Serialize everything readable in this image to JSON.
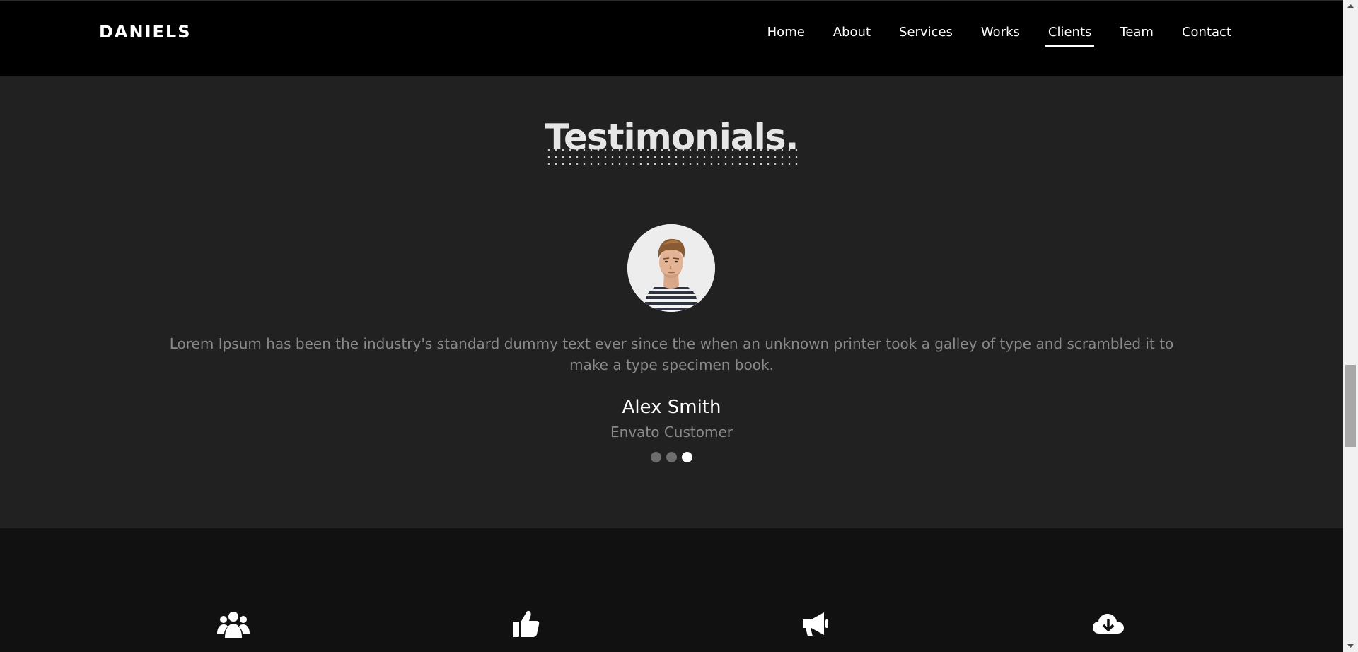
{
  "navbar": {
    "brand": "DANIELS",
    "items": [
      {
        "label": "Home",
        "active": false
      },
      {
        "label": "About",
        "active": false
      },
      {
        "label": "Services",
        "active": false
      },
      {
        "label": "Works",
        "active": false
      },
      {
        "label": "Clients",
        "active": true
      },
      {
        "label": "Team",
        "active": false
      },
      {
        "label": "Contact",
        "active": false
      }
    ]
  },
  "testimonials": {
    "title": "Testimonials.",
    "quote": "Lorem Ipsum has been the industry's standard dummy text ever since the when an unknown printer took a galley of type and scrambled it to make a type specimen book.",
    "author": "Alex Smith",
    "role": "Envato Customer",
    "slide_count": 3,
    "active_slide": 3
  },
  "features": {
    "icons": [
      "users-icon",
      "thumbs-up-icon",
      "megaphone-icon",
      "cloud-download-icon"
    ]
  },
  "colors": {
    "navbar_bg": "#000000",
    "section_bg": "#212121",
    "features_bg": "#111111",
    "muted_text": "#8a8a8a"
  }
}
